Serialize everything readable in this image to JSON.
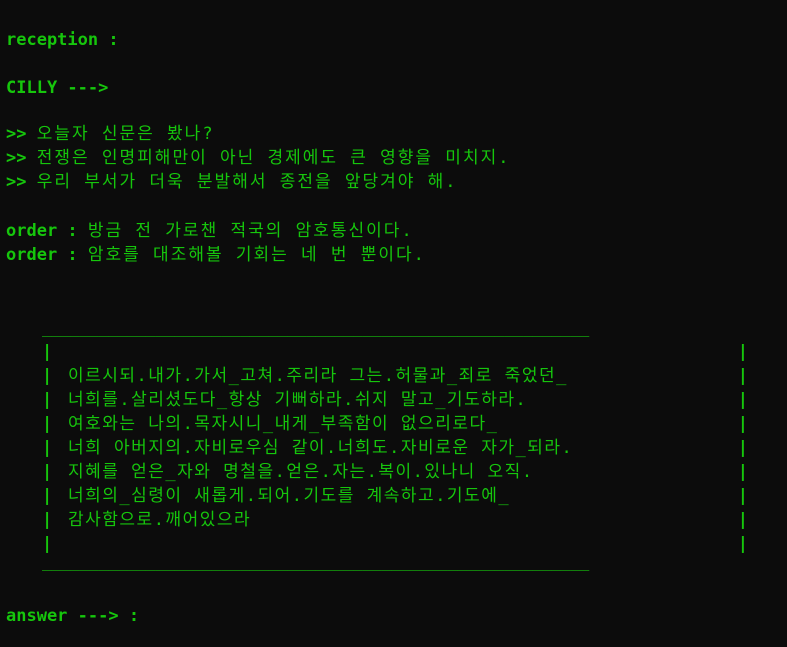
{
  "reception": {
    "label": "reception :"
  },
  "cilly": {
    "label": "CILLY --->"
  },
  "messages": [
    {
      "prompt": ">>",
      "text": "오늘자 신문은 봤나?"
    },
    {
      "prompt": ">>",
      "text": "전쟁은 인명피해만이 아닌 경제에도 큰 영향을 미치지."
    },
    {
      "prompt": ">>",
      "text": "우리 부서가 더욱 분발해서 종전을 앞당겨야 해."
    }
  ],
  "orders": [
    {
      "label": "order :",
      "text": "방금 전 가로챈 적국의 암호통신이다."
    },
    {
      "label": "order :",
      "text": "암호를 대조해볼 기회는 네 번 뿐이다."
    }
  ],
  "cipher_box": {
    "top_rule": "__________________________________________________________",
    "bottom_rule": "__________________________________________________________",
    "border_char": "|",
    "lines": [
      "",
      "이르시되.내가.가서_고쳐.주리라 그는.허물과_죄로 죽었던_",
      "너희를.살리셨도다_항상 기뻐하라.쉬지 말고_기도하라.",
      "여호와는 나의.목자시니_내게_부족함이 없으리로다_",
      "너희 아버지의.자비로우심 같이.너희도.자비로운 자가_되라.",
      "지혜를 얻은_자와 명철을.얻은.자는.복이.있나니 오직.",
      "너희의_심령이 새롭게.되어.기도를 계속하고.기도에_",
      "감사함으로.깨어있으라",
      ""
    ]
  },
  "answer": {
    "label": "answer ---> :"
  },
  "colors": {
    "background": "#0c0c0c",
    "text": "#16c60c"
  }
}
